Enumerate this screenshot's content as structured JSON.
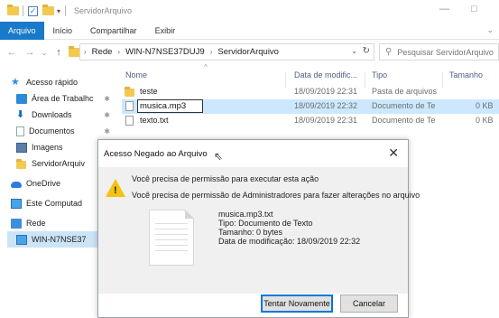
{
  "window": {
    "title": "ServidorArquivo",
    "minimize_glyph": "—",
    "maximize_glyph": "□"
  },
  "ribbon": {
    "tabs": [
      "Arquivo",
      "Início",
      "Compartilhar",
      "Exibir"
    ],
    "active_tab": "Arquivo"
  },
  "address": {
    "path": [
      "Rede",
      "WIN-N7NSE37DUJ9",
      "ServidorArquivo"
    ],
    "search_placeholder": "Pesquisar ServidorArquivo"
  },
  "sidebar": {
    "items": [
      {
        "label": "Acesso rápido",
        "icon": "star-icon"
      },
      {
        "label": "Área de Trabalhc",
        "icon": "desktop-icon",
        "pinned": true
      },
      {
        "label": "Downloads",
        "icon": "download-icon",
        "pinned": true
      },
      {
        "label": "Documentos",
        "icon": "documents-icon",
        "pinned": true
      },
      {
        "label": "Imagens",
        "icon": "pictures-icon"
      },
      {
        "label": "ServidorArquiv",
        "icon": "folder-icon"
      },
      {
        "label": "OneDrive",
        "icon": "onedrive-icon"
      },
      {
        "label": "Este Computad",
        "icon": "computer-icon"
      },
      {
        "label": "Rede",
        "icon": "network-icon"
      },
      {
        "label": "WIN-N7NSE37",
        "icon": "computer-icon",
        "selected": true
      }
    ]
  },
  "columns": [
    "Nome",
    "Data de modific...",
    "Tipo",
    "Tamanho"
  ],
  "files": [
    {
      "name": "teste",
      "date": "18/09/2019 22:31",
      "type": "Pasta de arquivos",
      "size": "",
      "icon": "folder-icon"
    },
    {
      "name": "musica.mp3",
      "date": "18/09/2019 22:32",
      "type": "Documento de Te",
      "size": "0 KB",
      "icon": "text-file-icon",
      "renaming": true
    },
    {
      "name": "texto.txt",
      "date": "18/09/2019 22:31",
      "type": "Documento de Te",
      "size": "0 KB",
      "icon": "text-file-icon"
    }
  ],
  "dialog": {
    "title": "Acesso Negado ao Arquivo",
    "close_glyph": "✕",
    "message_1": "Você precisa de permissão para executar esta ação",
    "message_2": "Você precisa de permissão de Administradores para fazer alterações no arquivo",
    "file_name": "musica.mp3.txt",
    "file_type": "Tipo: Documento de Texto",
    "file_size": "Tamanho: 0 bytes",
    "file_modified": "Data de modificação: 18/09/2019 22:32",
    "retry_button": "Tentar Novamente",
    "cancel_button": "Cancelar",
    "icon": "warning-icon"
  }
}
